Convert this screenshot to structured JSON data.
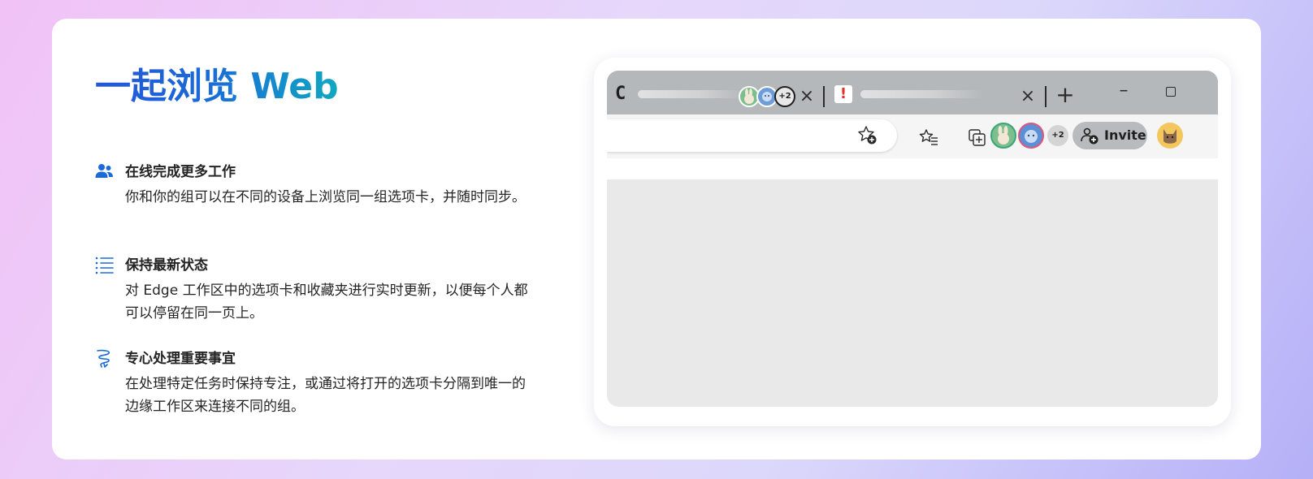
{
  "title": "一起浏览 Web",
  "features": [
    {
      "icon": "people-icon",
      "title": "在线完成更多工作",
      "description": "你和你的组可以在不同的设备上浏览同一组选项卡，并随时同步。"
    },
    {
      "icon": "list-icon",
      "title": "保持最新状态",
      "description": "对 Edge 工作区中的选项卡和收藏夹进行实时更新，以便每个人都可以停留在同一页上。"
    },
    {
      "icon": "focus-squiggle-icon",
      "title": "专心处理重要事宜",
      "description": "在处理特定任务时保持专注，或通过将打开的选项卡分隔到唯一的边缘工作区来连接不同的组。"
    }
  ],
  "browser": {
    "tabs": [
      {
        "favicon": "C",
        "extra_collaborators": "+2"
      },
      {
        "favicon": "!"
      }
    ],
    "toolbar": {
      "extra_collaborators": "+2",
      "invite_label": "Invite"
    }
  },
  "colors": {
    "title_gradient_start": "#2556d8",
    "title_gradient_end": "#10a8c0",
    "icon_blue": "#1a6ad8",
    "tabbar_gray": "#b5b8bb",
    "content_gray": "#e9e9e9"
  }
}
